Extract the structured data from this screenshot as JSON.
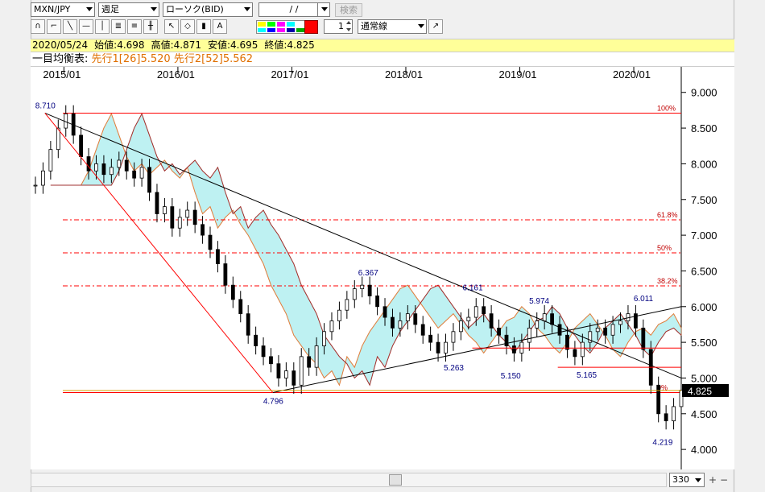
{
  "toolbar": {
    "pair": "MXN/JPY",
    "period": "週足",
    "chart_kind": "ローソク(BID)",
    "date": "/ /",
    "search": "検索",
    "spin_value": "1",
    "line_style": "通常線"
  },
  "ohlc": {
    "date": "2020/05/24",
    "open": "始値:4.698",
    "high": "高値:4.871",
    "low": "安値:4.695",
    "close": "終値:4.825"
  },
  "ichimoku": {
    "label": "一目均衡表:",
    "span1": "先行1[26]5.520",
    "span2": "先行2[52]5.562"
  },
  "bottom": {
    "zoom": "330"
  },
  "colors": {
    "fib_line": "#ff0000",
    "cloud_up": "#aeeef0",
    "cloud_down": "#f5b48a",
    "current_price_bg": "#000000",
    "highlight": "#ffff99"
  },
  "chart_data": {
    "type": "candlestick",
    "x_ticks": [
      "2015/01",
      "2016/01",
      "2017/01",
      "2018/01",
      "2019/01",
      "2020/01"
    ],
    "y_ticks": [
      "9.000",
      "8.500",
      "8.000",
      "7.500",
      "7.000",
      "6.500",
      "6.000",
      "5.500",
      "5.000",
      "4.500",
      "4.000"
    ],
    "ylim": [
      3.9,
      9.2
    ],
    "fib_labels": [
      "100%",
      "61.8%",
      "50%",
      "38.2%",
      "0%"
    ],
    "fib_levels": [
      8.71,
      7.216,
      6.753,
      6.29,
      4.796
    ],
    "current_price": "4.825",
    "annotations": [
      {
        "label": "8.710",
        "x": "2014/11",
        "y": 8.71
      },
      {
        "label": "4.796",
        "x": "2016/11",
        "y": 4.796
      },
      {
        "label": "6.367",
        "x": "2017/09",
        "y": 6.367
      },
      {
        "label": "5.263",
        "x": "2018/06",
        "y": 5.263
      },
      {
        "label": "6.161",
        "x": "2018/08",
        "y": 6.161
      },
      {
        "label": "5.150",
        "x": "2018/12",
        "y": 5.15
      },
      {
        "label": "5.974",
        "x": "2019/03",
        "y": 5.974
      },
      {
        "label": "5.165",
        "x": "2019/08",
        "y": 5.165
      },
      {
        "label": "6.011",
        "x": "2020/02",
        "y": 6.011
      },
      {
        "label": "4.219",
        "x": "2020/04",
        "y": 4.219
      }
    ],
    "closes": [
      7.7,
      7.9,
      8.2,
      8.5,
      8.7,
      8.4,
      8.1,
      7.9,
      8.0,
      7.85,
      7.95,
      8.05,
      7.9,
      7.8,
      7.95,
      7.6,
      7.3,
      7.4,
      7.1,
      7.25,
      7.35,
      7.15,
      7.0,
      6.8,
      6.6,
      6.3,
      6.1,
      5.9,
      5.6,
      5.45,
      5.3,
      5.2,
      5.0,
      5.1,
      4.9,
      5.3,
      5.15,
      5.45,
      5.65,
      5.8,
      5.95,
      6.1,
      6.25,
      6.3,
      6.15,
      6.0,
      5.85,
      5.7,
      5.8,
      5.9,
      5.75,
      5.6,
      5.5,
      5.35,
      5.5,
      5.65,
      5.8,
      5.85,
      6.0,
      5.9,
      5.7,
      5.6,
      5.45,
      5.35,
      5.5,
      5.7,
      5.8,
      5.9,
      5.75,
      5.6,
      5.4,
      5.3,
      5.5,
      5.65,
      5.7,
      5.6,
      5.75,
      5.8,
      5.9,
      5.7,
      5.4,
      4.9,
      4.5,
      4.4,
      4.6,
      4.83
    ]
  }
}
